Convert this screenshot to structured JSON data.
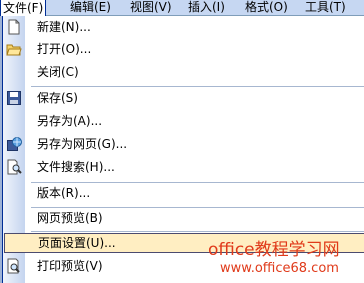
{
  "menubar": {
    "items": [
      {
        "label": "文件(F)"
      },
      {
        "label": "编辑(E)"
      },
      {
        "label": "视图(V)"
      },
      {
        "label": "插入(I)"
      },
      {
        "label": "格式(O)"
      },
      {
        "label": "工具(T)"
      }
    ]
  },
  "menu": {
    "items": [
      {
        "label": "新建(N)...",
        "icon": "new-document-icon"
      },
      {
        "label": "打开(O)...",
        "icon": "open-folder-icon"
      },
      {
        "label": "关闭(C)"
      },
      {
        "label": "保存(S)",
        "icon": "save-disk-icon"
      },
      {
        "label": "另存为(A)..."
      },
      {
        "label": "另存为网页(G)...",
        "icon": "save-as-web-icon"
      },
      {
        "label": "文件搜索(H)...",
        "icon": "file-search-icon"
      },
      {
        "label": "版本(R)..."
      },
      {
        "label": "网页预览(B)"
      },
      {
        "label": "页面设置(U)..."
      },
      {
        "label": "打印预览(V)",
        "icon": "print-preview-icon"
      }
    ]
  },
  "watermark": {
    "title": "office教程学习网",
    "url": "www.office68.com"
  }
}
